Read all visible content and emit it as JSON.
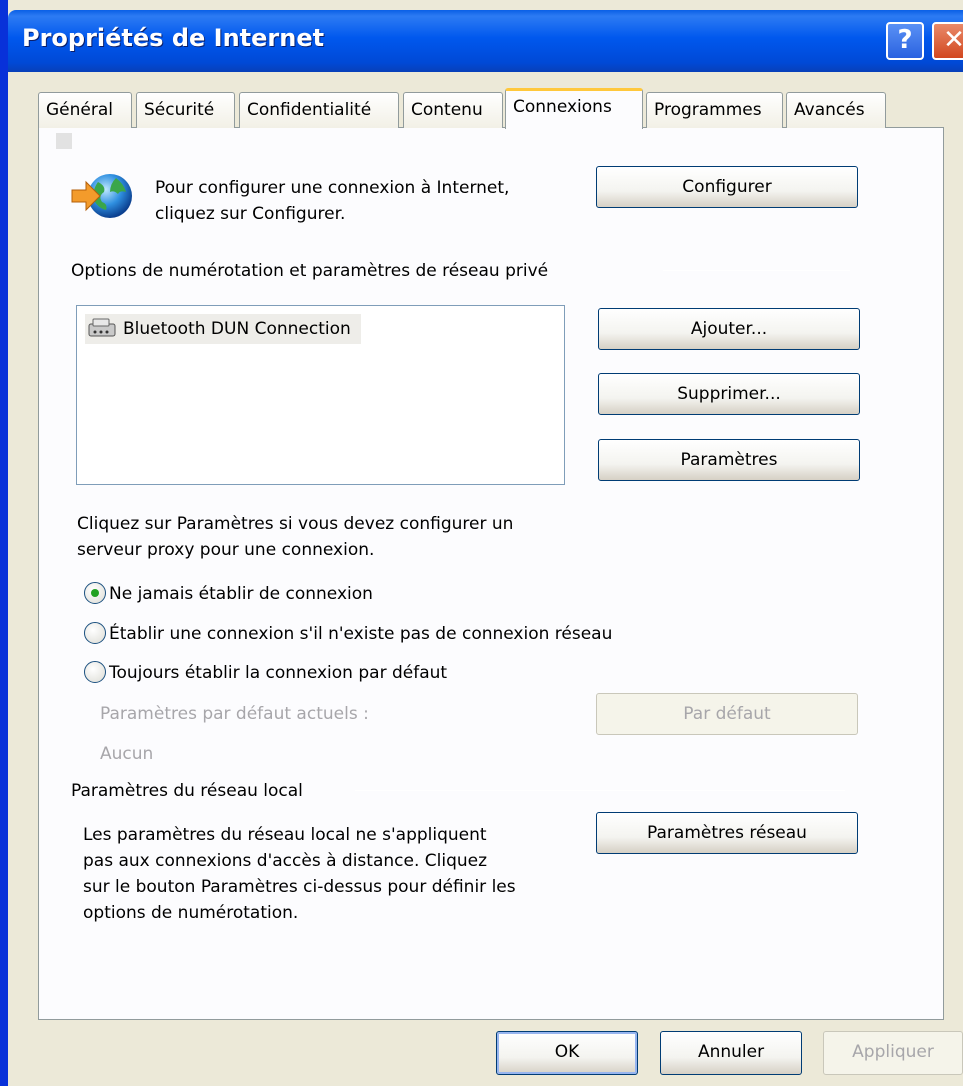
{
  "window": {
    "title": "Propriétés de Internet"
  },
  "titlebar": {
    "help_label": "?",
    "close_label": "✕"
  },
  "tabs": [
    {
      "label": "Général"
    },
    {
      "label": "Sécurité"
    },
    {
      "label": "Confidentialité"
    },
    {
      "label": "Contenu"
    },
    {
      "label": "Connexions"
    },
    {
      "label": "Programmes"
    },
    {
      "label": "Avancés"
    }
  ],
  "setup": {
    "description": "Pour configurer une connexion à Internet, cliquez sur Configurer.",
    "line1": "Pour configurer une connexion à Internet,",
    "line2": "cliquez sur Configurer.",
    "button": "Configurer"
  },
  "dialup": {
    "group_label": "Options de numérotation et paramètres de réseau privé",
    "connections": [
      {
        "name": "Bluetooth DUN Connection"
      }
    ],
    "add_button": "Ajouter...",
    "remove_button": "Supprimer...",
    "settings_button": "Paramètres",
    "proxy_hint_line1": "Cliquez sur Paramètres si vous devez configurer un",
    "proxy_hint_line2": "serveur proxy pour une connexion.",
    "options": [
      {
        "label": "Ne jamais établir de connexion",
        "checked": true
      },
      {
        "label": "Établir une connexion s'il n'existe pas de connexion réseau",
        "checked": false
      },
      {
        "label": "Toujours établir la connexion par défaut",
        "checked": false
      }
    ],
    "current_default_label": "Paramètres par défaut actuels :",
    "current_default_value": "Aucun",
    "set_default_button": "Par défaut"
  },
  "lan": {
    "group_label": "Paramètres du réseau local",
    "line1": "Les paramètres du réseau local ne s'appliquent",
    "line2": "pas aux connexions d'accès à distance. Cliquez",
    "line3": "sur le bouton Paramètres ci-dessus pour définir les",
    "line4": "options de numérotation.",
    "button": "Paramètres réseau"
  },
  "footer": {
    "ok": "OK",
    "cancel": "Annuler",
    "apply": "Appliquer"
  },
  "colors": {
    "titlebar": "#0058EE",
    "face": "#ECE9D8",
    "tab_highlight": "#FFC83C",
    "radio_dot": "#21A121"
  }
}
